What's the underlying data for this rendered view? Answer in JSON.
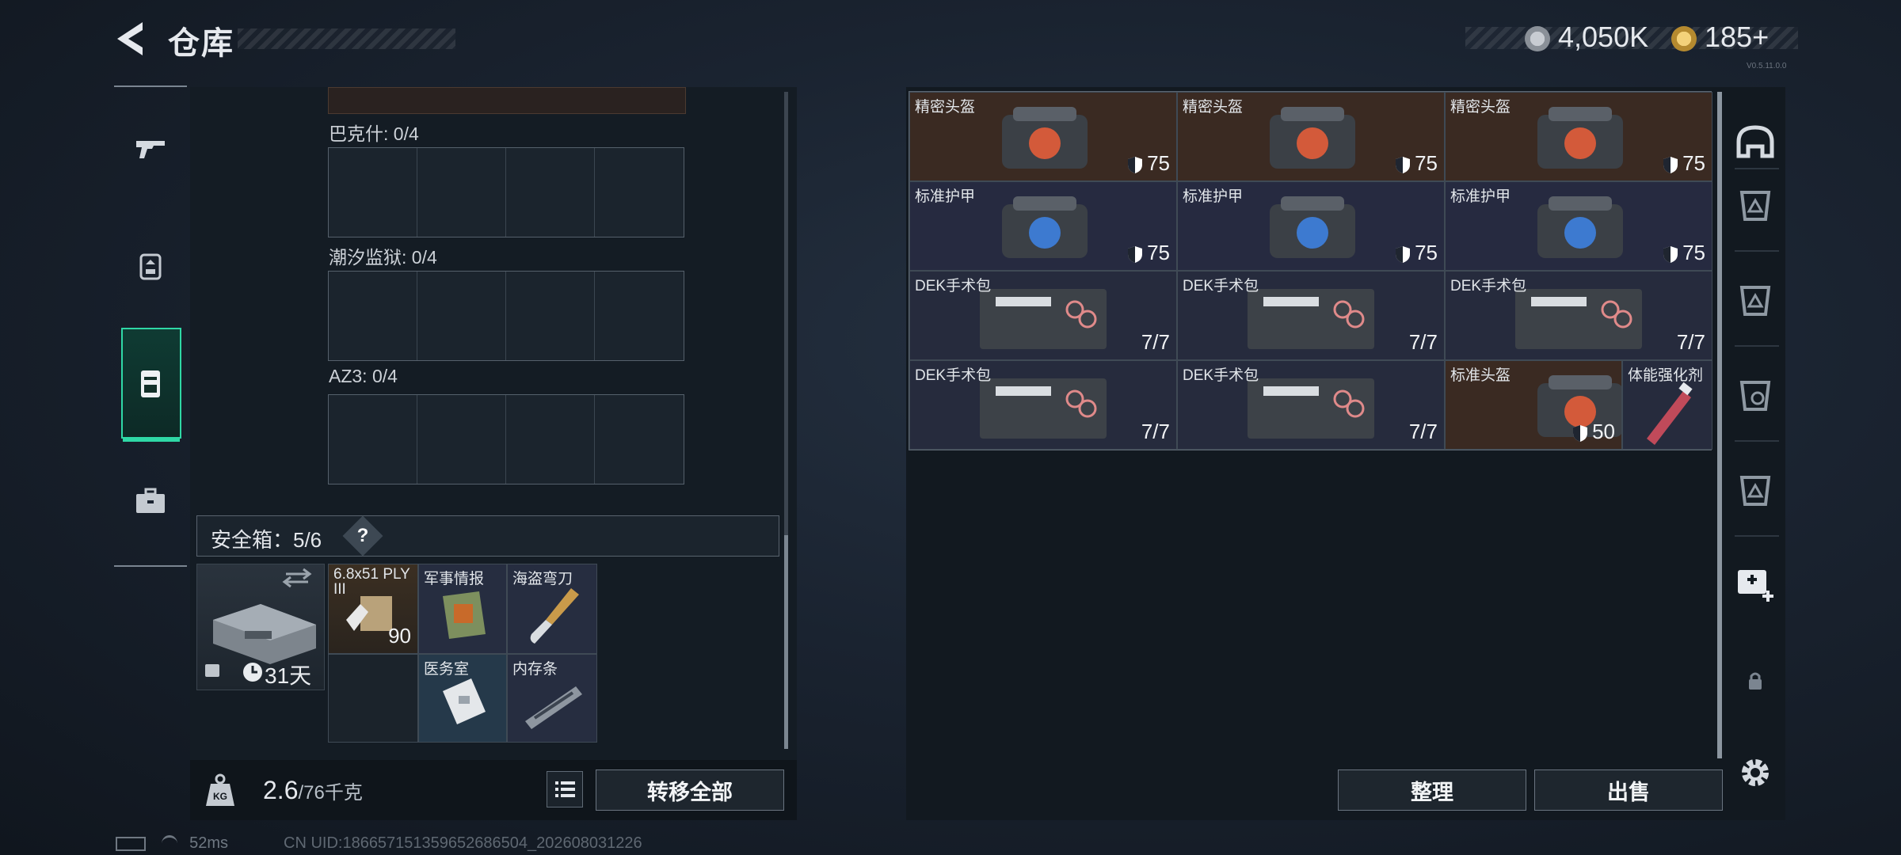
{
  "header": {
    "title": "仓库"
  },
  "currency": {
    "coin1": "4,050K",
    "coin2": "185+"
  },
  "version_text": "V0.5.11.0.0",
  "left_rail": {
    "items": [
      "gun-icon",
      "backpack-icon",
      "safebox-icon",
      "briefcase-icon"
    ],
    "active_index": 2
  },
  "slots": [
    {
      "label": "巴克什: 0/4"
    },
    {
      "label": "潮汐监狱: 0/4"
    },
    {
      "label": "AZ3: 0/4"
    }
  ],
  "safebox": {
    "label": "安全箱：5/6",
    "help": "?",
    "duration": "31天",
    "items": [
      {
        "name": "6.8x51 PLY III",
        "qty": "90"
      },
      {
        "name": "军事情报",
        "qty": ""
      },
      {
        "name": "海盗弯刀",
        "qty": ""
      },
      {
        "name": "",
        "qty": ""
      },
      {
        "name": "医务室",
        "qty": ""
      },
      {
        "name": "内存条",
        "qty": ""
      }
    ]
  },
  "weight": {
    "current": "2.6",
    "max": "/76千克"
  },
  "buttons": {
    "transfer_all": "转移全部",
    "sort": "整理",
    "sell": "出售"
  },
  "stash": {
    "rows": [
      [
        {
          "name": "精密头盔",
          "val": "75"
        },
        {
          "name": "精密头盔",
          "val": "75"
        },
        {
          "name": "精密头盔",
          "val": "75"
        }
      ],
      [
        {
          "name": "标准护甲",
          "val": "75"
        },
        {
          "name": "标准护甲",
          "val": "75"
        },
        {
          "name": "标准护甲",
          "val": "75"
        }
      ],
      [
        {
          "name": "DEK手术包",
          "val": "7/7"
        },
        {
          "name": "DEK手术包",
          "val": "7/7"
        },
        {
          "name": "DEK手术包",
          "val": "7/7"
        }
      ],
      [
        {
          "name": "DEK手术包",
          "val": "7/7"
        },
        {
          "name": "DEK手术包",
          "val": "7/7"
        },
        {
          "name": "标准头盔",
          "val": "50"
        },
        {
          "name": "体能强化剂",
          "val": ""
        }
      ]
    ]
  },
  "status": {
    "ping": "52ms",
    "uid": "CN UID:18665715135965268650​4_202608031226"
  },
  "colors": {
    "accent": "#2fd8a6",
    "helmet_bg": "#3a2a22",
    "armor_bg": "#262a40"
  }
}
